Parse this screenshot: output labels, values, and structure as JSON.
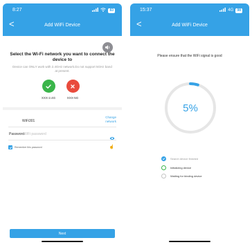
{
  "left": {
    "status": {
      "time": "8:27",
      "battery": "83"
    },
    "header": {
      "back": "<",
      "title": "Add WiFi Device"
    },
    "select": {
      "title": "Select the Wi-Fi network you want to connect the device to",
      "note": "Device can ONLY work with 2.4GHz network.Do not support 5GHz band at present."
    },
    "options": [
      {
        "label": "XXX-2.4G",
        "status": "supported"
      },
      {
        "label": "XXX-5G",
        "status": "unsupported"
      }
    ],
    "wifi": {
      "name": "WiFi301",
      "change_label": "Change network"
    },
    "password": {
      "label": "Password",
      "placeholder": "WiFi password"
    },
    "remember": {
      "label": "Remember this password"
    },
    "next_label": "Next"
  },
  "right": {
    "status": {
      "time": "15:37",
      "signal": "4G",
      "battery": "98"
    },
    "header": {
      "back": "<",
      "title": "Add WiFi Device"
    },
    "ensure_text": "Please ensure that the WiFi signal is good",
    "progress": {
      "percent_label": "5%",
      "value": 0.05
    },
    "steps": [
      {
        "label": "Search device finished",
        "state": "done"
      },
      {
        "label": "Initializing device",
        "state": "active"
      },
      {
        "label": "Waiting for binding device",
        "state": "pending"
      }
    ]
  },
  "colors": {
    "accent": "#35a2e6",
    "success": "#3ab54a",
    "error": "#e94b3c"
  }
}
